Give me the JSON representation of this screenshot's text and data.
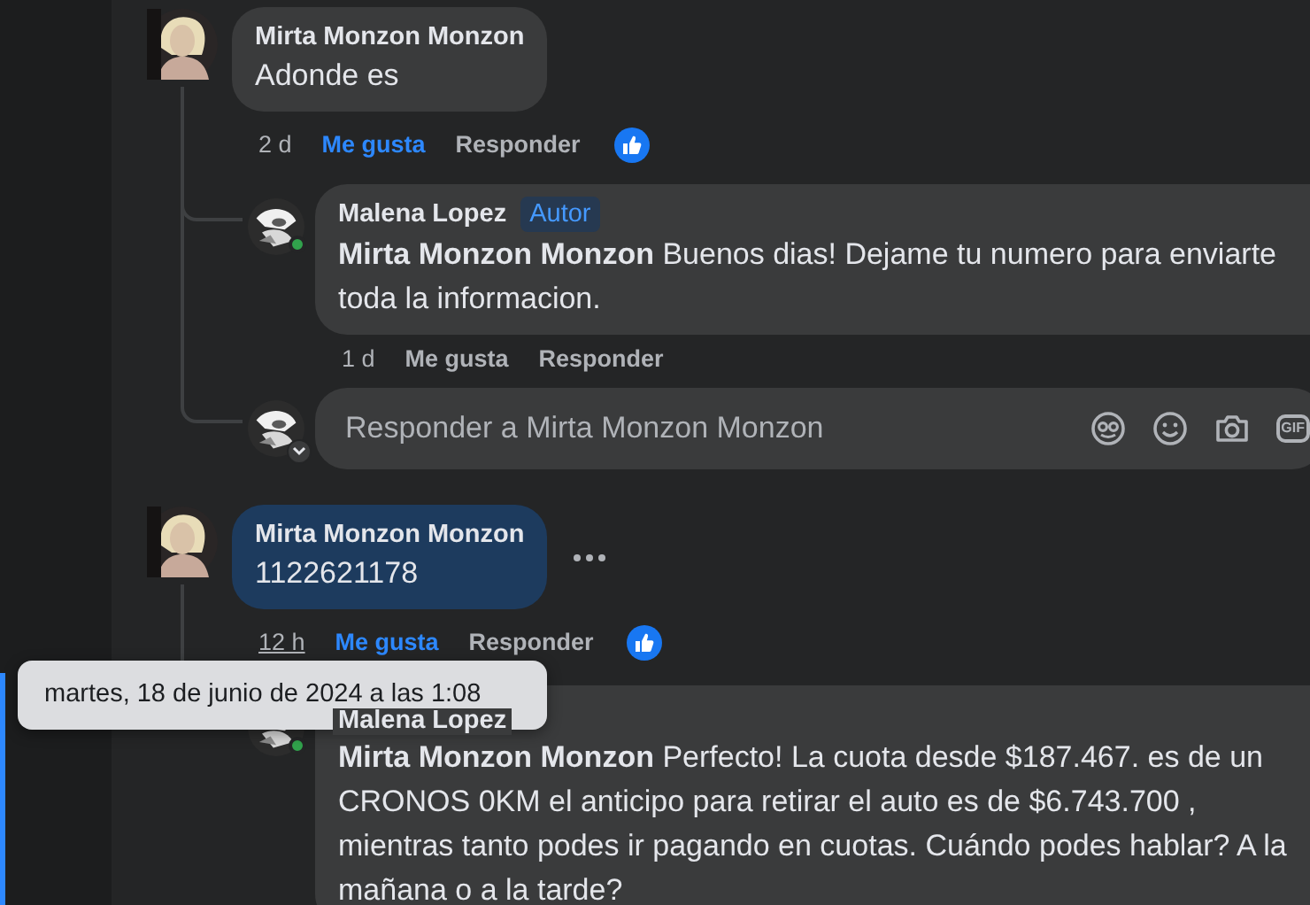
{
  "comments": [
    {
      "author": "Mirta Monzon Monzon",
      "text": "Adonde es",
      "highlighted": false,
      "more": false,
      "time": "2 d",
      "time_hovered": false,
      "like_label": "Me gusta",
      "liked": true,
      "reply_label": "Responder",
      "reacted": true,
      "replies": [
        {
          "author": "Malena Lopez",
          "author_badge": "Autor",
          "online": true,
          "text": "**Mirta Monzon Monzon** Buenos dias! Dejame tu numero para enviarte toda la informacion.",
          "time": "1 d",
          "like_label": "Me gusta",
          "liked": false,
          "reply_label": "Responder",
          "reacted": false
        }
      ],
      "reply_box": {
        "placeholder": "Responder a Mirta Monzon Monzon",
        "gif_label": "GIF"
      }
    },
    {
      "author": "Mirta Monzon Monzon",
      "text": "1122621178",
      "highlighted": true,
      "more": true,
      "time": "12 h",
      "time_hovered": true,
      "like_label": "Me gusta",
      "liked": true,
      "reply_label": "Responder",
      "reacted": true,
      "replies": [
        {
          "author": "Malena Lopez",
          "online": true,
          "text": "**Mirta Monzon Monzon** Perfecto! La cuota desde $187.467. es de un CRONOS 0KM el anticipo para retirar el auto es de $6.743.700 , mientras tanto podes ir pagando en cuotas. Cuándo podes hablar? A la mañana o a la tarde?"
        }
      ]
    }
  ],
  "tooltip": {
    "text": "martes, 18 de junio de 2024 a las 1:08"
  }
}
